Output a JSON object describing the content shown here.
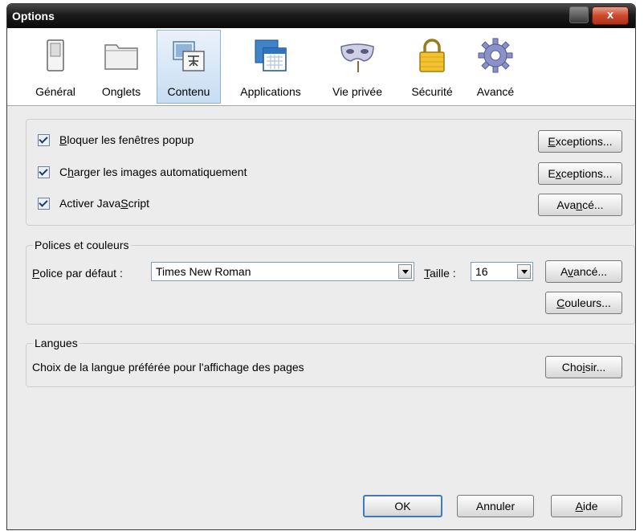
{
  "window": {
    "title": "Options",
    "close_glyph": "x"
  },
  "tabs": [
    {
      "label": "Général",
      "icon": "general-switch-icon"
    },
    {
      "label": "Onglets",
      "icon": "tabs-folder-icon"
    },
    {
      "label": "Contenu",
      "icon": "content-images-icon",
      "selected": true
    },
    {
      "label": "Applications",
      "icon": "applications-calendar-icon"
    },
    {
      "label": "Vie privée",
      "icon": "privacy-mask-icon"
    },
    {
      "label": "Sécurité",
      "icon": "security-lock-icon"
    },
    {
      "label": "Avancé",
      "icon": "advanced-gear-icon"
    }
  ],
  "content": {
    "block_popups": {
      "pre": "",
      "key": "B",
      "post": "loquer les fenêtres popup",
      "checked": true
    },
    "load_images": {
      "pre": "C",
      "key": "h",
      "post": "arger les images automatiquement",
      "checked": true
    },
    "enable_js": {
      "pre": "Activer Java",
      "key": "S",
      "post": "cript",
      "checked": true
    },
    "exceptions_popup": {
      "pre": "",
      "key": "E",
      "post": "xceptions..."
    },
    "exceptions_images": {
      "pre": "E",
      "key": "x",
      "post": "ceptions..."
    },
    "advanced_js": {
      "pre": "Ava",
      "key": "n",
      "post": "cé..."
    }
  },
  "fonts": {
    "legend": "Polices et couleurs",
    "default_font_label": {
      "pre": "",
      "key": "P",
      "post": "olice par défaut :"
    },
    "default_font_value": "Times New Roman",
    "size_label": {
      "pre": "",
      "key": "T",
      "post": "aille :"
    },
    "size_value": "16",
    "advanced_button": {
      "pre": "A",
      "key": "v",
      "post": "ancé..."
    },
    "colors_button": {
      "pre": "",
      "key": "C",
      "post": "ouleurs..."
    }
  },
  "languages": {
    "legend": "Langues",
    "description": "Choix de la langue préférée pour l'affichage des pages",
    "choose_button": {
      "pre": "Cho",
      "key": "i",
      "post": "sir..."
    }
  },
  "footer": {
    "ok": "OK",
    "cancel": "Annuler",
    "help": {
      "pre": "",
      "key": "A",
      "post": "ide"
    }
  }
}
